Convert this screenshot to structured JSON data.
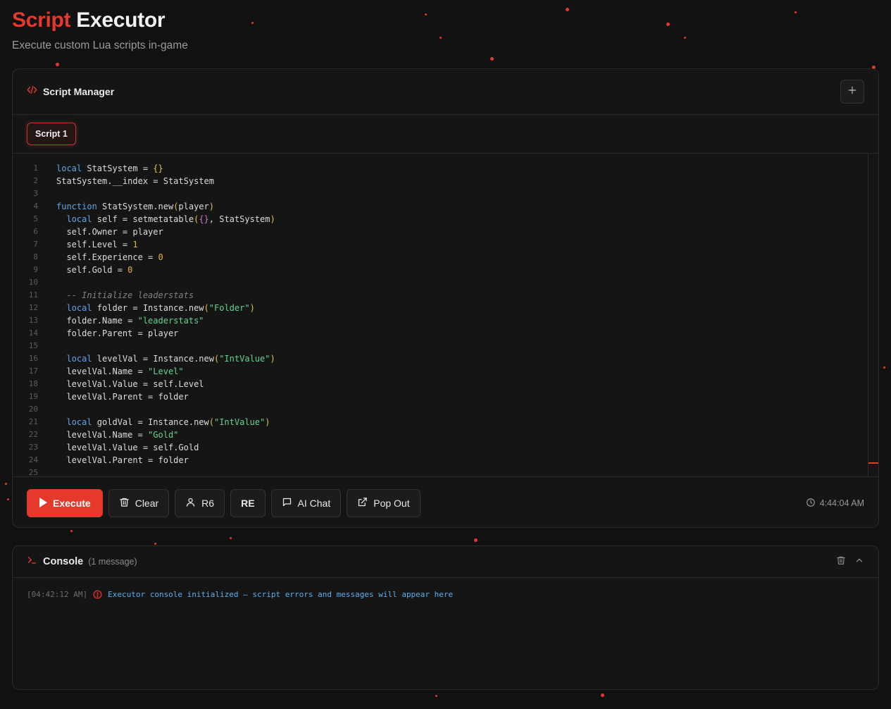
{
  "header": {
    "title_accent": "Script",
    "title_rest": " Executor",
    "subtitle": "Execute custom Lua scripts in-game"
  },
  "manager": {
    "title": "Script Manager",
    "add_icon": "plus-icon",
    "tabs": [
      {
        "label": "Script 1",
        "active": true
      }
    ]
  },
  "editor": {
    "line_numbers": [
      "1",
      "2",
      "3",
      "4",
      "5",
      "6",
      "7",
      "8",
      "9",
      "10",
      "11",
      "12",
      "13",
      "14",
      "15",
      "16",
      "17",
      "18",
      "19",
      "20",
      "21",
      "22",
      "23",
      "24",
      "25"
    ]
  },
  "toolbar": {
    "execute_label": "Execute",
    "clear_label": "Clear",
    "r6_label": "R6",
    "re_label": "RE",
    "ai_chat_label": "AI Chat",
    "pop_out_label": "Pop Out",
    "time": "4:44:04 AM"
  },
  "console": {
    "title": "Console",
    "count": "(1 message)",
    "messages": [
      {
        "timestamp": "[04:42:12 AM]",
        "text": "Executor console initialized — script errors and messages will appear here"
      }
    ]
  },
  "colors": {
    "accent": "#e5392c",
    "background": "#111111",
    "panel": "#151515",
    "info_text": "#58b0f0"
  }
}
